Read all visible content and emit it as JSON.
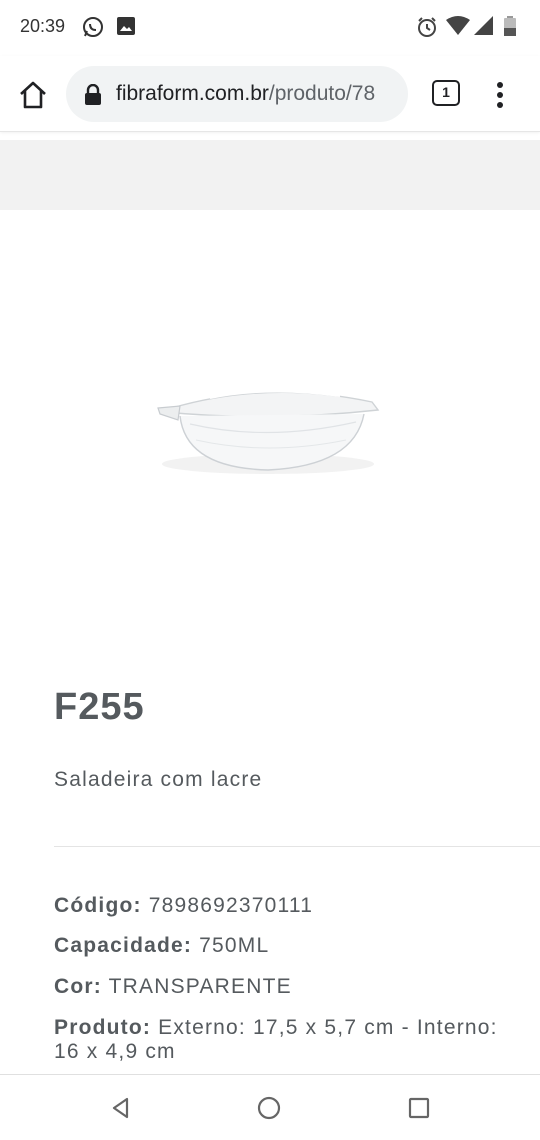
{
  "status_bar": {
    "time": "20:39",
    "icons": [
      "whatsapp-icon",
      "gallery-icon",
      "alarm-icon",
      "wifi-icon",
      "signal-icon",
      "battery-icon"
    ]
  },
  "browser": {
    "url_domain": "fibraform.com.br",
    "url_path": "/produto/78",
    "tab_count": "1",
    "icons": [
      "home-icon",
      "lock-icon",
      "tabs-icon",
      "more-vert-icon"
    ]
  },
  "product": {
    "title": "F255",
    "subtitle": "Saladeira com lacre",
    "image": "salad-bowl-with-lid",
    "specs": [
      {
        "key": "Código:",
        "value": "7898692370111"
      },
      {
        "key": "Capacidade:",
        "value": "750ML"
      },
      {
        "key": "Cor:",
        "value": "TRANSPARENTE"
      },
      {
        "key": "Produto:",
        "value": "Externo: 17,5 x 5,7 cm - Interno: 16 x 4,9 cm"
      }
    ]
  },
  "nav_bar": {
    "icons": [
      "back-icon",
      "home-circle-icon",
      "recents-icon"
    ]
  }
}
